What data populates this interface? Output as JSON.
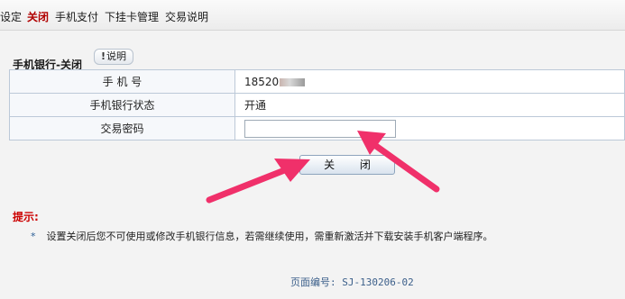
{
  "nav": {
    "items": [
      {
        "label": "设定",
        "active": false
      },
      {
        "label": "关闭",
        "active": true
      },
      {
        "label": "手机支付",
        "active": false
      },
      {
        "label": "下挂卡管理",
        "active": false
      },
      {
        "label": "交易说明",
        "active": false
      }
    ]
  },
  "section": {
    "title": "手机银行-关闭",
    "help_label": "说明",
    "help_icon": "info-icon"
  },
  "form": {
    "rows": [
      {
        "label": "手 机 号",
        "value": "18520"
      },
      {
        "label": "手机银行状态",
        "value": "开通"
      },
      {
        "label": "交易密码",
        "value": ""
      }
    ]
  },
  "actions": {
    "close_label": "关 闭"
  },
  "tips": {
    "title": "提示:",
    "bullet": "*",
    "text": "设置关闭后您不可使用或修改手机银行信息，若需继续使用，需重新激活并下载安装手机客户端程序。"
  },
  "footer": {
    "page_id": "页面编号: SJ-130206-02"
  },
  "colors": {
    "arrow": "#f0306a",
    "active_nav": "#b00000",
    "tip_title": "#cc0000"
  }
}
